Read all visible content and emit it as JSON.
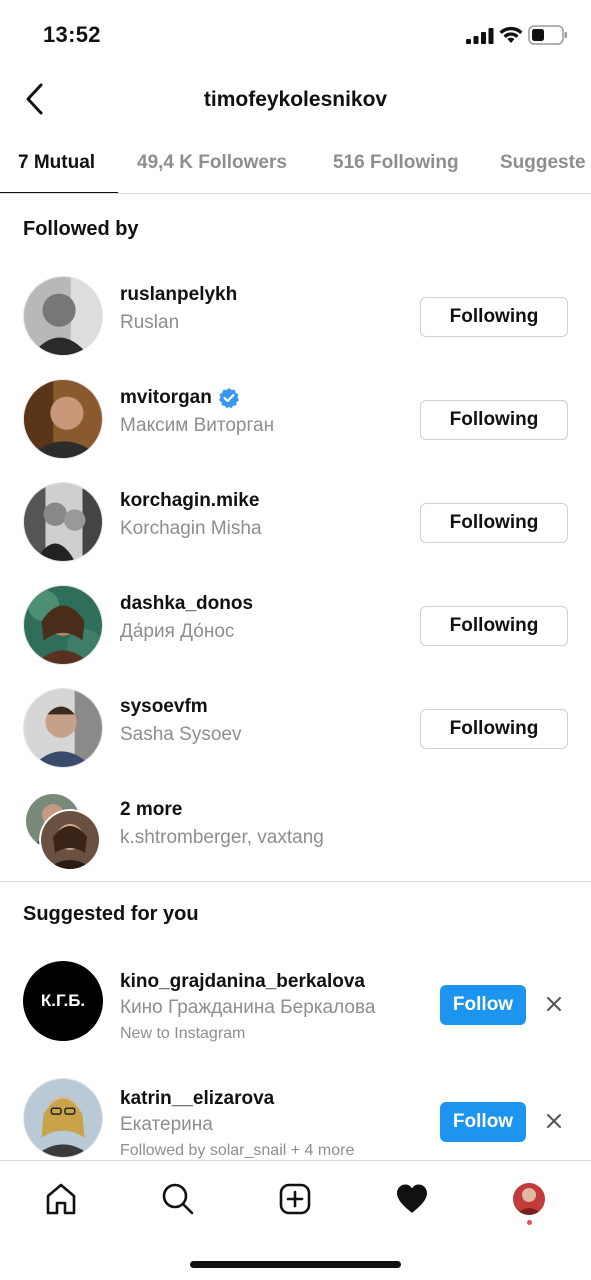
{
  "status_bar": {
    "time": "13:52"
  },
  "header": {
    "title": "timofeykolesnikov"
  },
  "tabs": [
    {
      "label": "7 Mutual",
      "active": true
    },
    {
      "label": "49,4 K Followers"
    },
    {
      "label": "516 Following"
    },
    {
      "label": "Suggeste"
    }
  ],
  "followed_by": {
    "title": "Followed by",
    "items": [
      {
        "username": "ruslanpelykh",
        "name": "Ruslan",
        "button": "Following",
        "verified": false
      },
      {
        "username": "mvitorgan",
        "name": "Максим Виторган",
        "button": "Following",
        "verified": true
      },
      {
        "username": "korchagin.mike",
        "name": "Korchagin Misha",
        "button": "Following",
        "verified": false
      },
      {
        "username": "dashka_donos",
        "name": "Да́рия До́нос",
        "button": "Following",
        "verified": false
      },
      {
        "username": "sysoevfm",
        "name": "Sasha Sysoev",
        "button": "Following",
        "verified": false
      }
    ],
    "more": {
      "label": "2 more",
      "names": "k.shtromberger, vaxtang"
    }
  },
  "suggested": {
    "title": "Suggested for you",
    "items": [
      {
        "username": "kino_grajdanina_berkalova",
        "name": "Кино Гражданина Беркалова",
        "meta": "New to Instagram",
        "button": "Follow",
        "avatar_text": "К.Г.Б."
      },
      {
        "username": "katrin__elizarova",
        "name": "Екатерина",
        "meta": "Followed by solar_snail + 4 more",
        "button": "Follow"
      }
    ]
  },
  "colors": {
    "accent": "#1d94ef",
    "secondary_text": "#8e8e8e",
    "verified": "#3897f0",
    "notification_dot": "#ed4956"
  },
  "tabbar": {
    "icons": [
      "home-icon",
      "search-icon",
      "new-post-icon",
      "activity-heart-icon",
      "profile-avatar"
    ]
  }
}
